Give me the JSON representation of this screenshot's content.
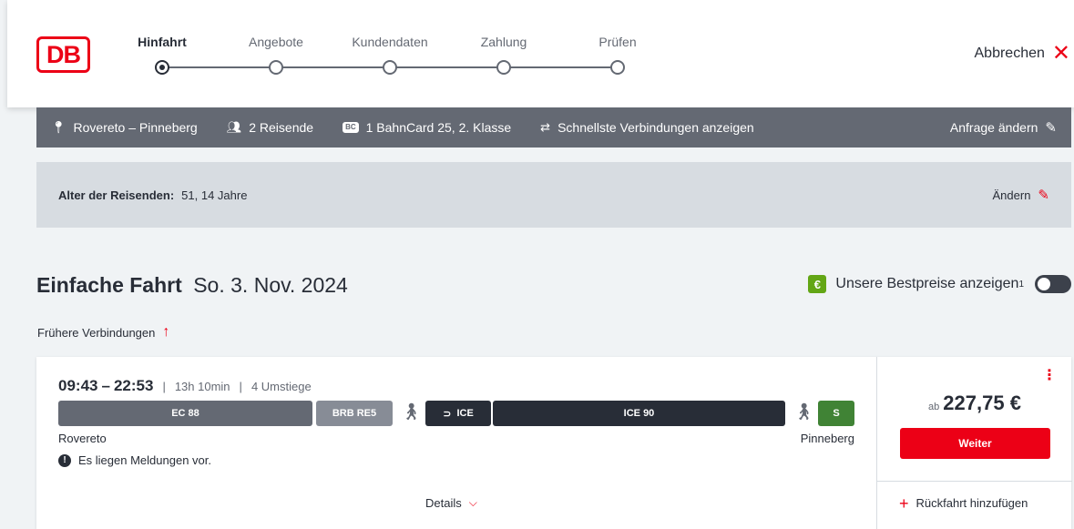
{
  "header": {
    "logo_text": "DB",
    "steps": [
      {
        "label": "Hinfahrt",
        "active": true
      },
      {
        "label": "Angebote",
        "active": false
      },
      {
        "label": "Kundendaten",
        "active": false
      },
      {
        "label": "Zahlung",
        "active": false
      },
      {
        "label": "Prüfen",
        "active": false
      }
    ],
    "cancel_label": "Abbrechen"
  },
  "summary": {
    "route": "Rovereto – Pinneberg",
    "travelers": "2 Reisende",
    "bahncard_badge": "BC",
    "bahncard": "1 BahnCard 25, 2. Klasse",
    "fastest": "Schnellste Verbindungen anzeigen",
    "edit_label": "Anfrage ändern"
  },
  "ages": {
    "label": "Alter der Reisenden:",
    "value": "51, 14 Jahre",
    "edit_label": "Ändern"
  },
  "title": {
    "main": "Einfache Fahrt",
    "date": "So. 3. Nov. 2024",
    "bestprice_icon": "€",
    "bestprice_label": "Unsere Bestpreise anzeigen",
    "bestprice_sup": "1",
    "bestprice_enabled": false
  },
  "earlier_label": "Frühere Verbindungen",
  "connection": {
    "departure": "09:43",
    "arrival": "22:53",
    "time_separator": "–",
    "duration": "13h 10min",
    "changes": "4 Umstiege",
    "segments": [
      {
        "label": "EC 88",
        "style": "grey"
      },
      {
        "label": "BRB RE5",
        "style": "lightgrey"
      },
      {
        "label": "ICE",
        "style": "dark"
      },
      {
        "label": "ICE 90",
        "style": "dark"
      },
      {
        "label": "S",
        "style": "green"
      }
    ],
    "from": "Rovereto",
    "to": "Pinneberg",
    "notice": "Es liegen Meldungen vor.",
    "details_label": "Details",
    "price_prefix": "ab",
    "price": "227,75 €",
    "button_label": "Weiter",
    "return_label": "Rückfahrt hinzufügen"
  },
  "colors": {
    "brand_red": "#ec0016",
    "summary_bg": "#646973",
    "dark": "#282d37",
    "green": "#408335",
    "bestprice_green": "#63a615"
  }
}
